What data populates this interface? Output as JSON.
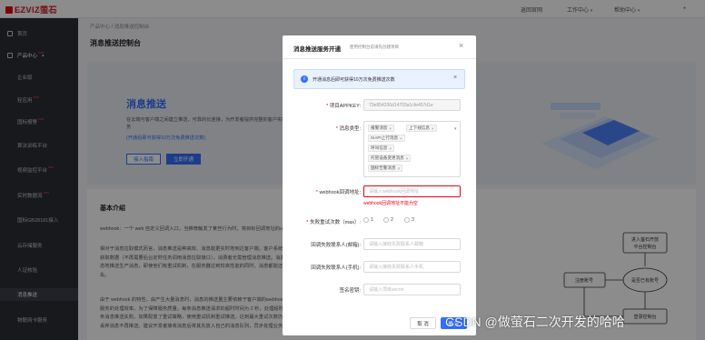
{
  "brand": {
    "name": "EZVIZ萤石",
    "tagline": "萤石开放平台 让智能生活更简单"
  },
  "topnav": {
    "home": "返回官网",
    "workbench": "工作中心",
    "help": "帮助中心"
  },
  "sidebar": {
    "items": [
      {
        "label": "首页",
        "hot": ""
      },
      {
        "label": "产品中心",
        "hot": "new"
      },
      {
        "label": "企业版",
        "hot": ""
      },
      {
        "label": "轻应用",
        "hot": "new"
      },
      {
        "label": "国标报警",
        "hot": "new"
      },
      {
        "label": "算法训练平台",
        "hot": ""
      },
      {
        "label": "视频监控平台",
        "hot": "new"
      },
      {
        "label": "实时数据流",
        "hot": "new"
      },
      {
        "label": "国标GB28181接入",
        "hot": ""
      },
      {
        "label": "云存储服务",
        "hot": ""
      },
      {
        "label": "人证核验",
        "hot": ""
      },
      {
        "label": "消息推送",
        "hot": ""
      },
      {
        "label": "物联网卡服务",
        "hot": ""
      }
    ]
  },
  "breadcrumb": {
    "root": "产品中心",
    "sep": "/",
    "current": "消息推送控制台"
  },
  "page": {
    "title": "消息推送控制台"
  },
  "hero": {
    "title": "消息推送",
    "desc": "在云端与客户端之间建立推送，可靠的长连接，为开发者提供完整的客户实时推送消息的服务",
    "link": "(开通后即可获得10万次免费推送次数)",
    "btn_docs": "接入指南",
    "btn_open": "立即开通"
  },
  "intro": {
    "title": "基本介绍",
    "p1": "webhook：一个 web 自定义回调入口，当推荐触发了某些行为时，将目标回调地址的url。",
    "p2": "相对于消息拉取模式而言，消息推送是种高效、消息能更实时地到达客户端，客户系统的更及便地获取数据（不再需要后台定时任务调用消息拉取接口），消费者无需管理消息推送。消费生产者动态地推送生产消息，即使他们有重试机制，在服务器达到较高性能的同时，消息都能还原可能丢失。",
    "p3": "由于 webhook 的特性，由产生大量消息时，消息的推送量主要依赖于客户端的webhook 消息处理服务的处理效率。为了保障服务质量，每条消息推送请求的超时时间为 2 秒，处理超时后，认为该条消息推送失败。如果配置了重试策略，使用重试机制重试推送。达到最大重试次数仍失败的，将丢弃消息不再推送。建议开发者接收消息后将其先放入自己的消息队列，异步处理业务。"
  },
  "flow": {
    "start": "进入萤石开放平台控制台",
    "decision": "是否已有账号",
    "register": "注册账号",
    "login": "登录控制台"
  },
  "dialog": {
    "title": "消息推送服务开通",
    "subtitle": "使用控制台前请先创建项目",
    "close": "×",
    "alert": "开通消息后即可获得10万次免费推送次数",
    "alert_close": "×",
    "appkey_label": "项目APPKEY:",
    "appkey_value": "73e854206d14703a1cfe457d1e",
    "types_label": "消息类型:",
    "types": [
      "报警消息",
      "上下线信息",
      "ISAPI上行消息",
      "呼叫信息",
      "托管设备变更消息",
      "国标告警消息"
    ],
    "webhook_label": "webhook回调地址:",
    "webhook_placeholder": "请输入webhook回调地址",
    "webhook_error": "webhook回调地址不能为空",
    "retry_label": "失败重试次数（max）:",
    "retry_options": [
      "1",
      "2",
      "3"
    ],
    "contact_email_label": "回调失败联系人(邮箱):",
    "contact_email_placeholder": "请输入接收失败联系人邮箱",
    "contact_phone_label": "回调失败联系人(手机):",
    "contact_phone_placeholder": "请输入接收失败联系人手机",
    "secret_label": "签名密钥:",
    "secret_placeholder": "请输入项目secret",
    "cancel": "取 消",
    "ok": "确 定"
  },
  "watermark": "CSDN @做萤石二次开发的哈哈"
}
